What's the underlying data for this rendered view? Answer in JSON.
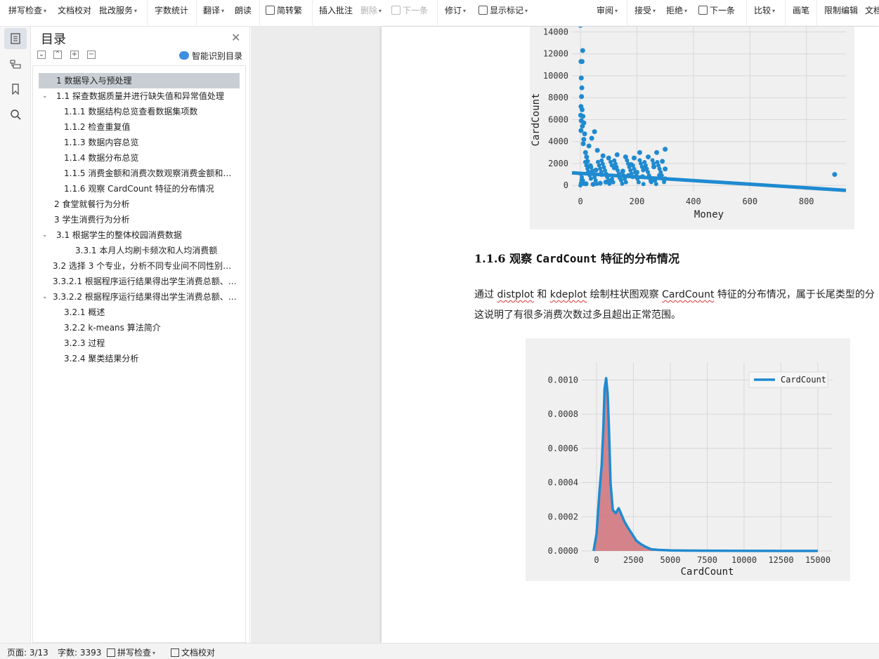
{
  "toolbar": {
    "items": [
      {
        "label": "拼写检查",
        "dropdown": true
      },
      {
        "label": "文档校对",
        "dropdown": false
      },
      {
        "label": "批改服务",
        "dropdown": true
      },
      {
        "label": "字数统计",
        "dropdown": false
      },
      {
        "label": "翻译",
        "dropdown": true
      },
      {
        "label": "朗读",
        "dropdown": false
      },
      {
        "label": "简转繁",
        "dropdown": false
      },
      {
        "label": "插入批注",
        "dropdown": false
      },
      {
        "label": "删除",
        "dropdown": true,
        "disabled": true
      },
      {
        "label": "下一条",
        "dropdown": false,
        "disabled": true
      },
      {
        "label": "修订",
        "dropdown": true
      },
      {
        "label": "显示标记",
        "dropdown": true
      },
      {
        "label": "审阅",
        "dropdown": true
      },
      {
        "label": "接受",
        "dropdown": true
      },
      {
        "label": "拒绝",
        "dropdown": true
      },
      {
        "label": "下一条",
        "dropdown": false
      },
      {
        "label": "比较",
        "dropdown": true
      },
      {
        "label": "画笔",
        "dropdown": false
      },
      {
        "label": "限制编辑",
        "dropdown": false
      },
      {
        "label": "文档",
        "dropdown": false
      }
    ]
  },
  "toc": {
    "title": "目录",
    "smart_label": "智能识别目录",
    "items": [
      {
        "label": "1 数据导入与预处理",
        "selected": true
      },
      {
        "label": "1.1 探查数据质量并进行缺失值和异常值处理",
        "expanded": true
      },
      {
        "label": "1.1.1 数据结构总览查看数据集项数"
      },
      {
        "label": "1.1.2 检查重复值"
      },
      {
        "label": "1.1.3 数据内容总览"
      },
      {
        "label": "1.1.4 数据分布总览"
      },
      {
        "label": "1.1.5 消费金额和消费次数观察消费金额和…"
      },
      {
        "label": "1.1.6 观察 CardCount 特征的分布情况"
      },
      {
        "label": "2 食堂就餐行为分析"
      },
      {
        "label": "3 学生消费行为分析"
      },
      {
        "label": "3.1 根据学生的整体校园消费数据",
        "expanded": true
      },
      {
        "label": "3.3.1 本月人均刷卡频次和人均消费额"
      },
      {
        "label": "3.2 选择 3 个专业，分析不同专业间不同性别…"
      },
      {
        "label": "3.3.2.1 根据程序运行结果得出学生消费总额、…"
      },
      {
        "label": "3.3.2.2 根据程序运行结果得出学生消费总额、…",
        "expanded": true
      },
      {
        "label": "3.2.1 概述"
      },
      {
        "label": "3.2.2 k-means 算法简介"
      },
      {
        "label": "3.2.3 过程"
      },
      {
        "label": "3.2.4 聚类结果分析"
      }
    ]
  },
  "document": {
    "heading_num": "1.1.6 观察",
    "heading_term": "CardCount",
    "heading_rest": "特征的分布情况",
    "para1": [
      "通过 ",
      "distplot",
      " 和 ",
      "kdeplot",
      " 绘制柱状图观察 ",
      "CardCount",
      " 特征的分布情况，属于长尾类型的分"
    ],
    "para2": "这说明了有很多消费次数过多且超出正常范围。"
  },
  "chart_data": [
    {
      "type": "scatter",
      "xlabel": "Money",
      "ylabel": "CardCount",
      "xticks": [
        0,
        200,
        400,
        600,
        800
      ],
      "yticks": [
        0,
        2000,
        4000,
        6000,
        8000,
        10000,
        12000,
        14000
      ],
      "xlim": [
        -30,
        940
      ],
      "ylim": [
        -500,
        14800
      ],
      "grid": true,
      "color": "#1f8ad0",
      "regression_line": {
        "x": [
          -30,
          940
        ],
        "y": [
          1150,
          -450
        ]
      },
      "points": [
        [
          0,
          14600
        ],
        [
          8,
          12300
        ],
        [
          2,
          11300
        ],
        [
          6,
          11300
        ],
        [
          3,
          9800
        ],
        [
          5,
          8900
        ],
        [
          4,
          8100
        ],
        [
          2,
          7200
        ],
        [
          6,
          6900
        ],
        [
          1,
          6400
        ],
        [
          9,
          6300
        ],
        [
          3,
          5900
        ],
        [
          12,
          5700
        ],
        [
          7,
          5400
        ],
        [
          2,
          5000
        ],
        [
          15,
          4700
        ],
        [
          50,
          4900
        ],
        [
          40,
          4300
        ],
        [
          30,
          3600
        ],
        [
          60,
          3200
        ],
        [
          80,
          2700
        ],
        [
          100,
          2500
        ],
        [
          130,
          2800
        ],
        [
          160,
          2600
        ],
        [
          190,
          2500
        ],
        [
          210,
          3000
        ],
        [
          240,
          2600
        ],
        [
          270,
          3000
        ],
        [
          300,
          3300
        ],
        [
          290,
          2200
        ],
        [
          260,
          1700
        ],
        [
          230,
          1500
        ],
        [
          200,
          1200
        ],
        [
          170,
          900
        ],
        [
          140,
          700
        ],
        [
          110,
          500
        ],
        [
          90,
          300
        ],
        [
          70,
          200
        ],
        [
          45,
          100
        ],
        [
          20,
          150
        ],
        [
          25,
          2200
        ],
        [
          35,
          1800
        ],
        [
          55,
          1400
        ],
        [
          75,
          1000
        ],
        [
          120,
          1600
        ],
        [
          150,
          1300
        ],
        [
          180,
          1900
        ],
        [
          220,
          800
        ],
        [
          250,
          400
        ],
        [
          280,
          900
        ],
        [
          300,
          600
        ],
        [
          300,
          1500
        ],
        [
          10,
          3800
        ],
        [
          12,
          4200
        ],
        [
          18,
          3000
        ],
        [
          22,
          2600
        ],
        [
          28,
          1200
        ],
        [
          5,
          500
        ],
        [
          3,
          200
        ],
        [
          900,
          1000
        ]
      ]
    },
    {
      "type": "area",
      "xlabel": "CardCount",
      "legend": [
        "CardCount"
      ],
      "legend_position": "top-right",
      "xticks": [
        0,
        2500,
        5000,
        7500,
        10000,
        12500,
        15000
      ],
      "yticks": [
        "0.0000",
        "0.0002",
        "0.0004",
        "0.0006",
        "0.0008",
        "0.0010"
      ],
      "xlim": [
        -1000,
        16000
      ],
      "ylim": [
        0,
        0.0011
      ],
      "grid": true,
      "line_color": "#1f8ad0",
      "fill_color": "#d0777e",
      "x": [
        -200,
        0,
        200,
        350,
        450,
        550,
        650,
        750,
        850,
        950,
        1100,
        1300,
        1500,
        1700,
        1900,
        2100,
        2400,
        2700,
        3000,
        3300,
        3700,
        4200,
        5000,
        6000,
        8000,
        10000,
        12500,
        15000
      ],
      "y": [
        0,
        0.0001,
        0.00035,
        0.0005,
        0.0007,
        0.00095,
        0.00101,
        0.00092,
        0.0007,
        0.0004,
        0.00024,
        0.00022,
        0.00025,
        0.00021,
        0.00017,
        0.00014,
        0.0001,
        6e-05,
        4e-05,
        2.5e-05,
        1e-05,
        6e-06,
        3e-06,
        2e-06,
        1e-06,
        5e-07,
        2e-07,
        0
      ]
    }
  ],
  "status": {
    "page": "页面: 3/13",
    "words": "字数: 3393",
    "spell": "拼写检查",
    "proof": "文档校对"
  }
}
